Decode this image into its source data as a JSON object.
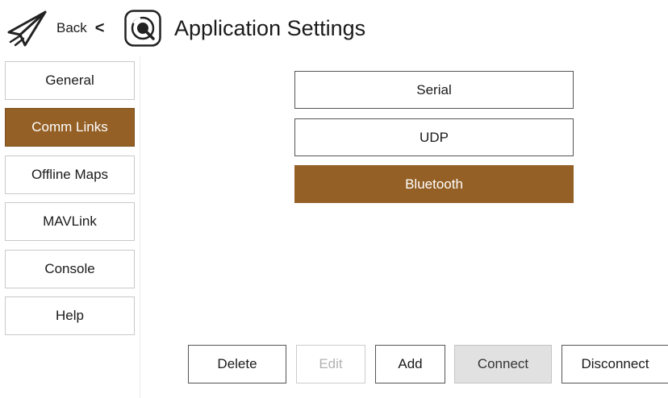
{
  "header": {
    "back_label": "Back",
    "chevron": "<",
    "title": "Application Settings",
    "icons": {
      "back": "paper-plane-icon",
      "logo": "qgroundcontrol-logo-icon"
    }
  },
  "sidebar": {
    "items": [
      {
        "label": "General",
        "active": false
      },
      {
        "label": "Comm Links",
        "active": true
      },
      {
        "label": "Offline Maps",
        "active": false
      },
      {
        "label": "MAVLink",
        "active": false
      },
      {
        "label": "Console",
        "active": false
      },
      {
        "label": "Help",
        "active": false
      }
    ]
  },
  "links": [
    {
      "label": "Serial",
      "selected": false
    },
    {
      "label": "UDP",
      "selected": false
    },
    {
      "label": "Bluetooth",
      "selected": true
    }
  ],
  "actions": {
    "delete": "Delete",
    "edit": "Edit",
    "add": "Add",
    "connect": "Connect",
    "disconnect": "Disconnect"
  },
  "colors": {
    "accent": "#946025",
    "border": "#555555",
    "disabled": "#b3b3b3",
    "button_grey": "#e1e1e1"
  }
}
